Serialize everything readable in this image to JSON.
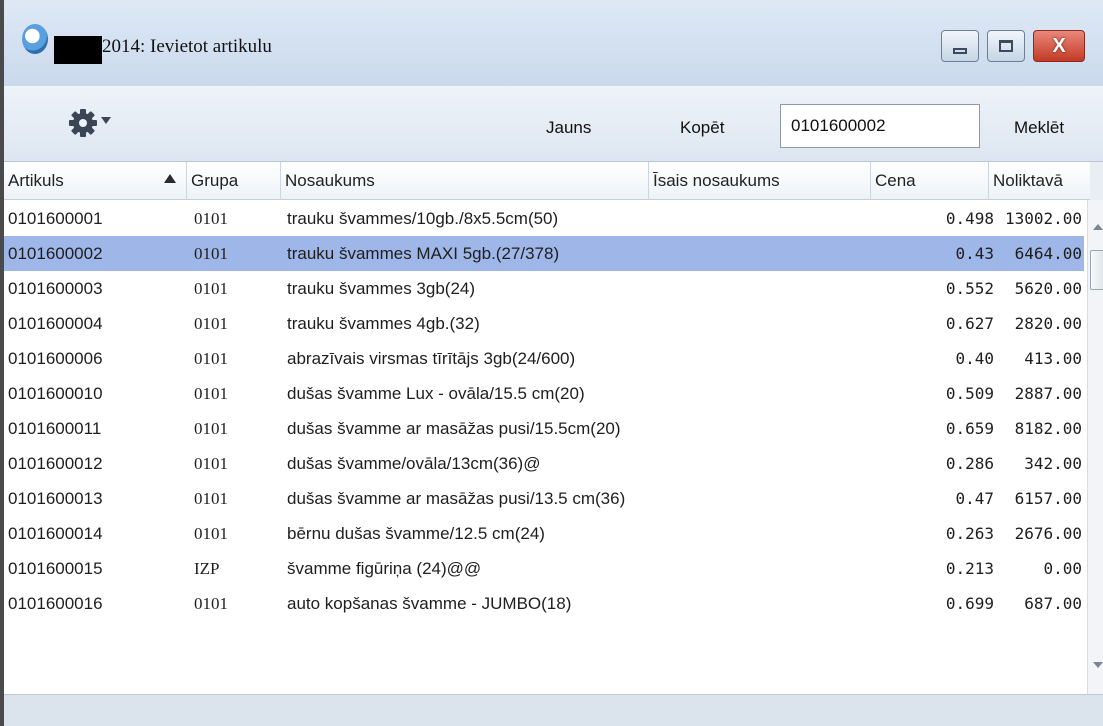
{
  "window": {
    "title": "2014: Ievietot artikulu",
    "controls": {
      "minimize_icon": "minimize-icon",
      "maximize_icon": "maximize-icon",
      "close_icon": "close-icon",
      "close_glyph": "X"
    }
  },
  "toolbar": {
    "settings_icon": "gear-icon",
    "new_label": "Jauns",
    "copy_label": "Kopēt",
    "search_value": "0101600002",
    "search_label": "Meklēt"
  },
  "grid": {
    "columns": [
      "Artikuls",
      "Grupa",
      "Nosaukums",
      "Īsais nosaukums",
      "Cena",
      "Noliktavā"
    ],
    "sort": {
      "column": "Artikuls",
      "direction": "ascending"
    },
    "selected_index": 1,
    "rows": [
      {
        "artikuls": "0101600001",
        "grupa": "0101",
        "nosaukums": "trauku švammes/10gb./8x5.5cm(50)",
        "isais": "",
        "cena": "0.498",
        "noliktava": "13002.00"
      },
      {
        "artikuls": "0101600002",
        "grupa": "0101",
        "nosaukums": "trauku švammes MAXI 5gb.(27/378)",
        "isais": "",
        "cena": "0.43",
        "noliktava": "6464.00"
      },
      {
        "artikuls": "0101600003",
        "grupa": "0101",
        "nosaukums": "trauku švammes 3gb(24)",
        "isais": "",
        "cena": "0.552",
        "noliktava": "5620.00"
      },
      {
        "artikuls": "0101600004",
        "grupa": "0101",
        "nosaukums": "trauku švammes 4gb.(32)",
        "isais": "",
        "cena": "0.627",
        "noliktava": "2820.00"
      },
      {
        "artikuls": "0101600006",
        "grupa": "0101",
        "nosaukums": "abrazīvais virsmas tīrītājs 3gb(24/600)",
        "isais": "",
        "cena": "0.40",
        "noliktava": "413.00"
      },
      {
        "artikuls": "0101600010",
        "grupa": "0101",
        "nosaukums": "dušas švamme Lux - ovāla/15.5 cm(20)",
        "isais": "",
        "cena": "0.509",
        "noliktava": "2887.00"
      },
      {
        "artikuls": "0101600011",
        "grupa": "0101",
        "nosaukums": "dušas švamme ar masāžas pusi/15.5cm(20)",
        "isais": "",
        "cena": "0.659",
        "noliktava": "8182.00"
      },
      {
        "artikuls": "0101600012",
        "grupa": "0101",
        "nosaukums": "dušas švamme/ovāla/13cm(36)@",
        "isais": "",
        "cena": "0.286",
        "noliktava": "342.00"
      },
      {
        "artikuls": "0101600013",
        "grupa": "0101",
        "nosaukums": "dušas švamme ar masāžas pusi/13.5 cm(36)",
        "isais": "",
        "cena": "0.47",
        "noliktava": "6157.00"
      },
      {
        "artikuls": "0101600014",
        "grupa": "0101",
        "nosaukums": "bērnu dušas švamme/12.5 cm(24)",
        "isais": "",
        "cena": "0.263",
        "noliktava": "2676.00"
      },
      {
        "artikuls": "0101600015",
        "grupa": "IZP",
        "nosaukums": "švamme figūriņa (24)@@",
        "isais": "",
        "cena": "0.213",
        "noliktava": "0.00"
      },
      {
        "artikuls": "0101600016",
        "grupa": "0101",
        "nosaukums": "auto kopšanas švamme - JUMBO(18)",
        "isais": "",
        "cena": "0.699",
        "noliktava": "687.00"
      }
    ]
  },
  "colors": {
    "selected_row": "#9fb6e8",
    "title_bar": "#c9d9ec",
    "close_button": "#c33a26"
  }
}
